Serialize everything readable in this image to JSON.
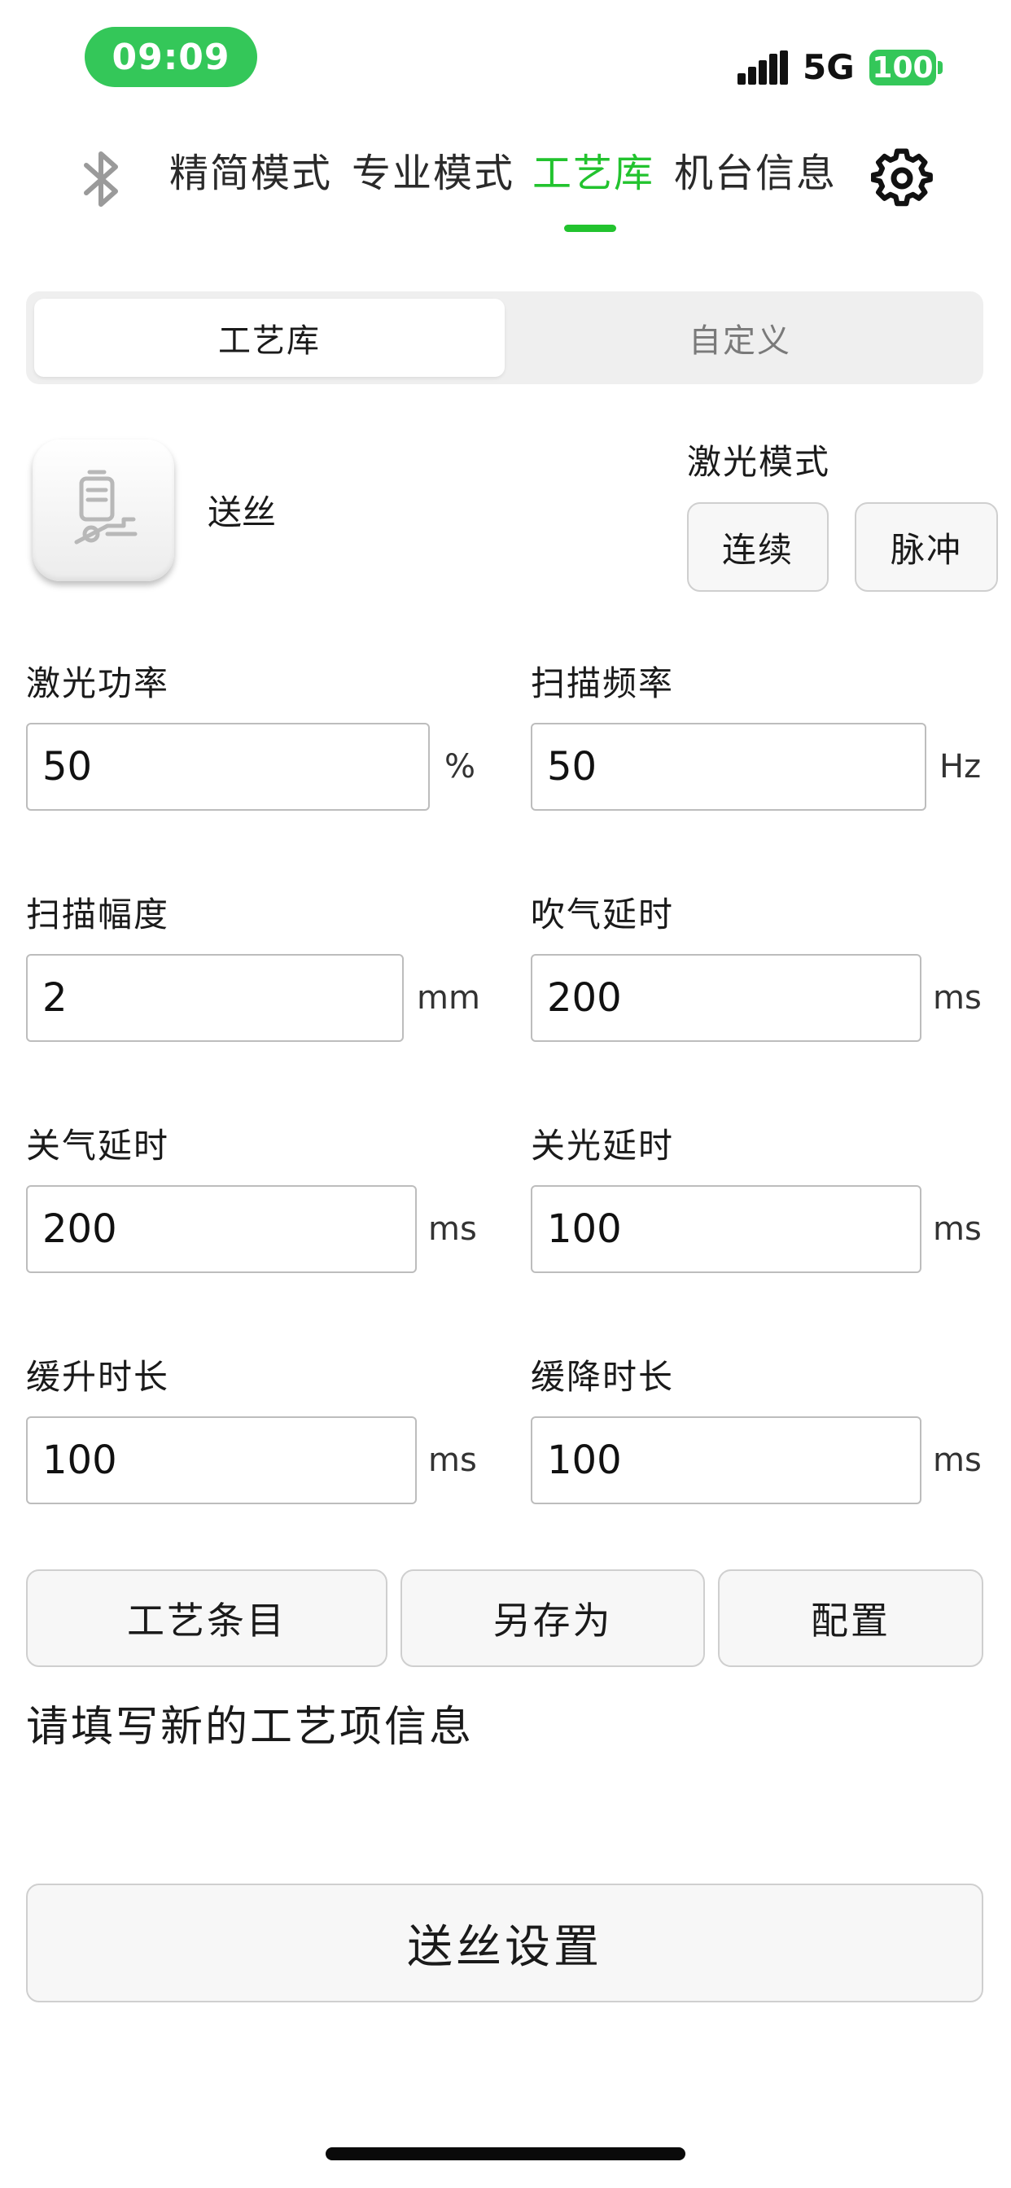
{
  "status_bar": {
    "time": "09:09",
    "network": "5G",
    "battery": "100",
    "battery_color": "#34c759"
  },
  "nav": {
    "bluetooth_icon": "bluetooth-icon",
    "tabs": [
      {
        "label": "精简模式",
        "active": false
      },
      {
        "label": "专业模式",
        "active": false
      },
      {
        "label": "工艺库",
        "active": true
      },
      {
        "label": "机台信息",
        "active": false
      }
    ],
    "settings_icon": "gear-icon",
    "accent_color": "#22c32e"
  },
  "segment": {
    "options": [
      "工艺库",
      "自定义"
    ],
    "selected": "工艺库"
  },
  "process": {
    "icon": "wire-feeder-icon",
    "name": "送丝",
    "laser_mode_label": "激光模式",
    "laser_modes": [
      "连续",
      "脉冲"
    ]
  },
  "fields": [
    {
      "label": "激光功率",
      "value": "50",
      "unit": "%"
    },
    {
      "label": "扫描频率",
      "value": "50",
      "unit": "Hz"
    },
    {
      "label": "扫描幅度",
      "value": "2",
      "unit": "mm"
    },
    {
      "label": "吹气延时",
      "value": "200",
      "unit": "ms"
    },
    {
      "label": "关气延时",
      "value": "200",
      "unit": "ms"
    },
    {
      "label": "关光延时",
      "value": "100",
      "unit": "ms"
    },
    {
      "label": "缓升时长",
      "value": "100",
      "unit": "ms"
    },
    {
      "label": "缓降时长",
      "value": "100",
      "unit": "ms"
    }
  ],
  "actions": [
    "工艺条目",
    "另存为",
    "配置"
  ],
  "hint": "请填写新的工艺项信息",
  "wire_settings_button": "送丝设置"
}
